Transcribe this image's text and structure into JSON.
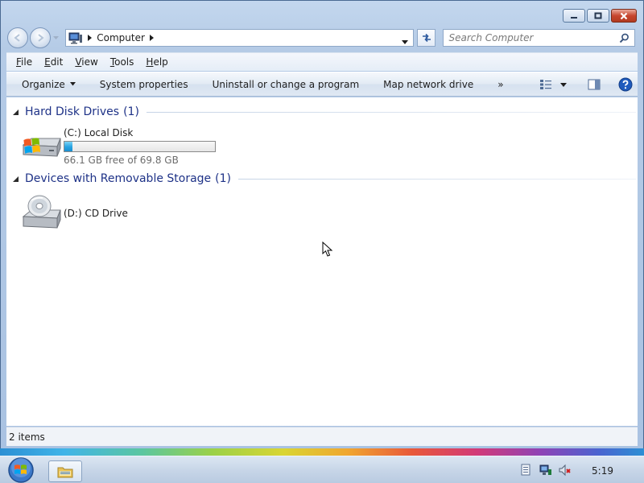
{
  "window": {
    "title": "Computer"
  },
  "address": {
    "crumb": "Computer"
  },
  "search": {
    "placeholder": "Search Computer"
  },
  "menu": {
    "file": {
      "first": "F",
      "rest": "ile"
    },
    "edit": {
      "first": "E",
      "rest": "dit"
    },
    "view": {
      "first": "V",
      "rest": "iew"
    },
    "tools": {
      "first": "T",
      "rest": "ools"
    },
    "help": {
      "first": "H",
      "rest": "elp"
    }
  },
  "commands": {
    "organize": "Organize",
    "system_properties": "System properties",
    "uninstall": "Uninstall or change a program",
    "map_drive": "Map network drive",
    "more": "»"
  },
  "groups": [
    {
      "title": "Hard Disk Drives",
      "count": "(1)",
      "items": [
        {
          "name": "(C:) Local Disk",
          "free_text": "66.1 GB free of 69.8 GB",
          "used_fraction": 0.053,
          "icon": "windows-hdd-icon"
        }
      ]
    },
    {
      "title": "Devices with Removable Storage",
      "count": "(1)",
      "items": [
        {
          "name": "(D:) CD Drive",
          "icon": "cd-drive-icon"
        }
      ]
    }
  ],
  "status": {
    "item_count": "2 items"
  },
  "taskbar": {
    "clock": "5:19"
  },
  "colors": {
    "group_header": "#1e3287",
    "bar_fill": "#27a3e2",
    "close_button": "#c7462e"
  }
}
